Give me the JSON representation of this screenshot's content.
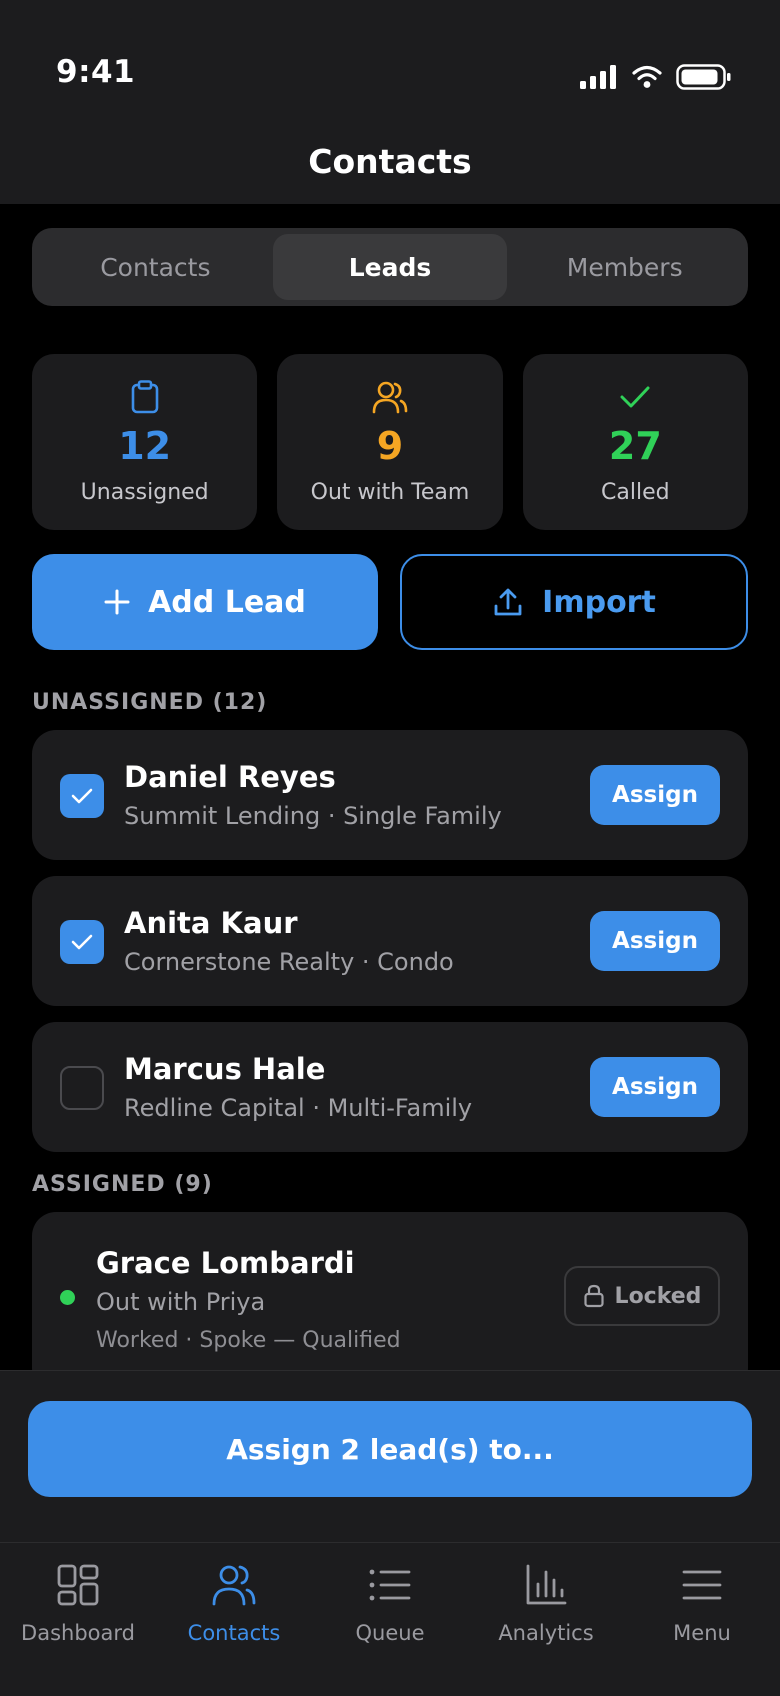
{
  "status_bar": {
    "time": "9:41"
  },
  "header": {
    "title": "Contacts"
  },
  "segments": [
    {
      "label": "Contacts",
      "active": false
    },
    {
      "label": "Leads",
      "active": true
    },
    {
      "label": "Members",
      "active": false
    }
  ],
  "stats": [
    {
      "value": "12",
      "label": "Unassigned",
      "icon": "clipboard-icon",
      "color": "#3d8ee8"
    },
    {
      "value": "9",
      "label": "Out with Team",
      "icon": "person-icon",
      "color": "#f5a623"
    },
    {
      "value": "27",
      "label": "Called",
      "icon": "checkmark-icon",
      "color": "#30d158"
    }
  ],
  "actions": {
    "add_lead": "Add Lead",
    "import": "Import"
  },
  "sections": {
    "unassigned": "UNASSIGNED (12)",
    "assigned": "ASSIGNED (9)"
  },
  "unassigned_leads": [
    {
      "name": "Daniel Reyes",
      "subtitle": "Summit Lending · Single Family",
      "checked": true,
      "action": "Assign"
    },
    {
      "name": "Anita Kaur",
      "subtitle": "Cornerstone Realty · Condo",
      "checked": true,
      "action": "Assign"
    },
    {
      "name": "Marcus Hale",
      "subtitle": "Redline Capital · Multi-Family",
      "checked": false,
      "action": "Assign"
    }
  ],
  "assigned_leads": [
    {
      "name": "Grace Lombardi",
      "subtitle": "Out with Priya",
      "meta": "Worked · Spoke — Qualified",
      "action": "Locked",
      "status_color": "#30d158"
    }
  ],
  "bulk_action": {
    "label": "Assign 2 lead(s) to..."
  },
  "tabs": [
    {
      "label": "Dashboard",
      "icon": "grid-icon",
      "active": false
    },
    {
      "label": "Contacts",
      "icon": "people-icon",
      "active": true
    },
    {
      "label": "Queue",
      "icon": "list-icon",
      "active": false
    },
    {
      "label": "Analytics",
      "icon": "bar-chart-icon",
      "active": false
    },
    {
      "label": "Menu",
      "icon": "hamburger-icon",
      "active": false
    }
  ],
  "colors": {
    "accent": "#3d8ee8",
    "background": "#000000",
    "card": "#1c1c1e"
  }
}
